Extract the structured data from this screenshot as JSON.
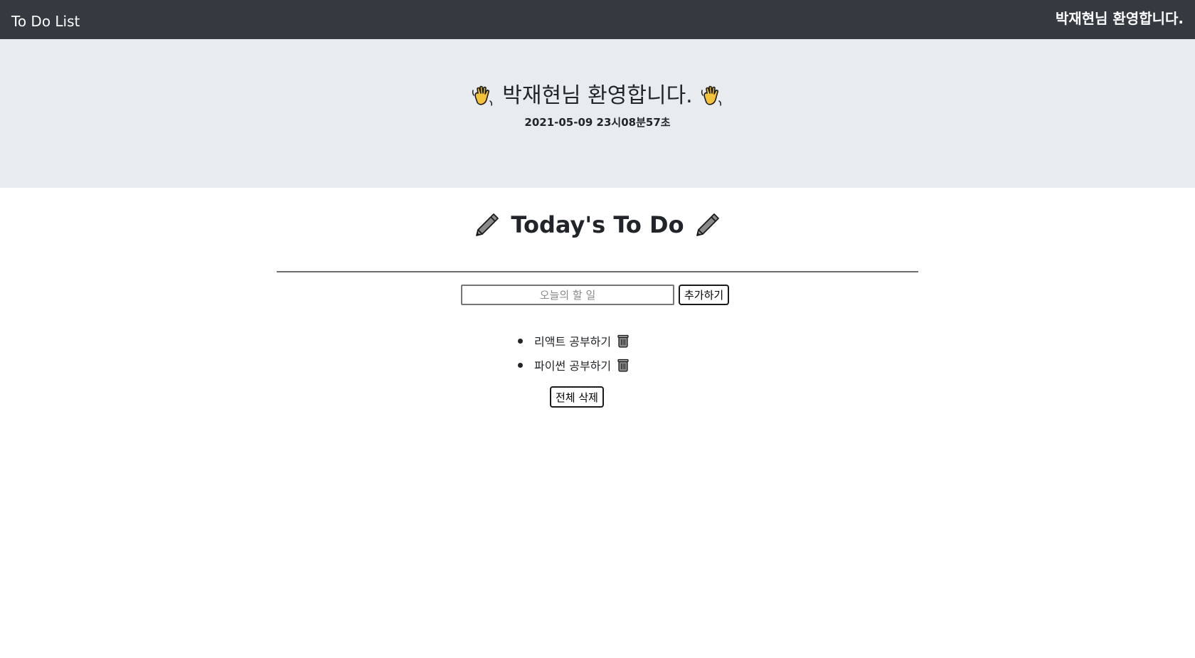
{
  "navbar": {
    "brand": "To Do List",
    "greeting": "박재현님 환영합니다."
  },
  "hero": {
    "title": "박재현님 환영합니다.",
    "left_icon": "waving-hand-icon",
    "right_icon": "waving-hand-icon",
    "datetime": "2021-05-09 23시08분57초"
  },
  "todo": {
    "title": "Today's To Do",
    "title_icon": "pencil-icon",
    "input": {
      "placeholder": "오늘의 할 일",
      "value": ""
    },
    "add_label": "추가하기",
    "items": [
      {
        "label": "리액트 공부하기",
        "delete_icon": "trash-icon"
      },
      {
        "label": "파이썬 공부하기",
        "delete_icon": "trash-icon"
      }
    ],
    "clear_label": "전체 삭제"
  },
  "colors": {
    "navbar_bg": "#343a40",
    "hero_bg": "#e9ecef",
    "text": "#212529"
  }
}
